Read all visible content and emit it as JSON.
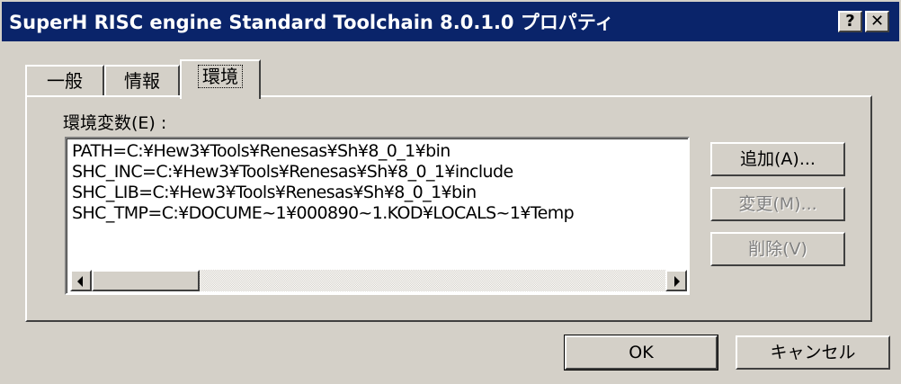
{
  "window": {
    "title": "SuperH RISC engine Standard Toolchain 8.0.1.0 プロパティ",
    "help_label": "?",
    "close_label": "✕"
  },
  "tabs": [
    {
      "label": "一般"
    },
    {
      "label": "情報"
    },
    {
      "label": "環境"
    }
  ],
  "env": {
    "label": "環境変数(E) :",
    "items": [
      "PATH=C:¥Hew3¥Tools¥Renesas¥Sh¥8_0_1¥bin",
      "SHC_INC=C:¥Hew3¥Tools¥Renesas¥Sh¥8_0_1¥include",
      "SHC_LIB=C:¥Hew3¥Tools¥Renesas¥Sh¥8_0_1¥bin",
      "SHC_TMP=C:¥DOCUME~1¥000890~1.KOD¥LOCALS~1¥Temp"
    ]
  },
  "buttons": {
    "add": "追加(A)...",
    "edit": "変更(M)...",
    "delete": "削除(V)",
    "ok": "OK",
    "cancel": "キャンセル"
  },
  "icons": {
    "scroll_left": "scroll-left-arrow",
    "scroll_right": "scroll-right-arrow"
  }
}
